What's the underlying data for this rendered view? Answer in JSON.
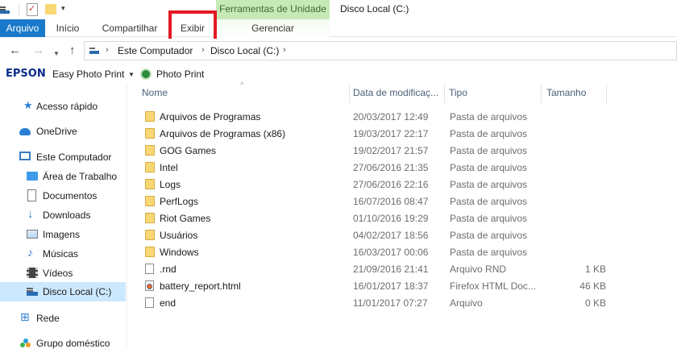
{
  "window": {
    "tools_context_label": "Ferramentas de Unidade",
    "title": "Disco Local (C:)"
  },
  "ribbon": {
    "tabs": [
      "Arquivo",
      "Início",
      "Compartilhar",
      "Exibir",
      "Gerenciar"
    ],
    "highlighted_tab": "Exibir",
    "highlight_color": "#e21a23",
    "file_tab_color": "#1979ca",
    "context_color": "#c7e9b6"
  },
  "address": {
    "crumbs": [
      "Este Computador",
      "Disco Local (C:)"
    ]
  },
  "epson": {
    "logo": "EPSON",
    "easy_photo_print": "Easy Photo Print",
    "photo_print": "Photo Print"
  },
  "navigation": {
    "items": [
      {
        "label": "Acesso rápido",
        "icon": "star-icon"
      },
      {
        "label": "OneDrive",
        "icon": "cloud-icon"
      },
      {
        "label": "Este Computador",
        "icon": "computer-icon"
      },
      {
        "label": "Área de Trabalho",
        "icon": "desktop-icon"
      },
      {
        "label": "Documentos",
        "icon": "document-icon"
      },
      {
        "label": "Downloads",
        "icon": "download-icon"
      },
      {
        "label": "Imagens",
        "icon": "image-icon"
      },
      {
        "label": "Músicas",
        "icon": "music-icon"
      },
      {
        "label": "Vídeos",
        "icon": "video-icon"
      },
      {
        "label": "Disco Local (C:)",
        "icon": "drive-icon",
        "selected": true
      },
      {
        "label": "Rede",
        "icon": "network-icon"
      },
      {
        "label": "Grupo doméstico",
        "icon": "homegroup-icon"
      }
    ]
  },
  "columns": [
    "Nome",
    "Data de modificaç...",
    "Tipo",
    "Tamanho"
  ],
  "files": [
    {
      "name": "Arquivos de Programas",
      "date": "20/03/2017 12:49",
      "type": "Pasta de arquivos",
      "size": "",
      "kind": "folder"
    },
    {
      "name": "Arquivos de Programas (x86)",
      "date": "19/03/2017 22:17",
      "type": "Pasta de arquivos",
      "size": "",
      "kind": "folder"
    },
    {
      "name": "GOG Games",
      "date": "19/02/2017 21:57",
      "type": "Pasta de arquivos",
      "size": "",
      "kind": "folder"
    },
    {
      "name": "Intel",
      "date": "27/06/2016 21:35",
      "type": "Pasta de arquivos",
      "size": "",
      "kind": "folder"
    },
    {
      "name": "Logs",
      "date": "27/06/2016 22:16",
      "type": "Pasta de arquivos",
      "size": "",
      "kind": "folder"
    },
    {
      "name": "PerfLogs",
      "date": "16/07/2016 08:47",
      "type": "Pasta de arquivos",
      "size": "",
      "kind": "folder"
    },
    {
      "name": "Riot Games",
      "date": "01/10/2016 19:29",
      "type": "Pasta de arquivos",
      "size": "",
      "kind": "folder"
    },
    {
      "name": "Usuários",
      "date": "04/02/2017 18:56",
      "type": "Pasta de arquivos",
      "size": "",
      "kind": "folder"
    },
    {
      "name": "Windows",
      "date": "16/03/2017 00:06",
      "type": "Pasta de arquivos",
      "size": "",
      "kind": "folder"
    },
    {
      "name": ".rnd",
      "date": "21/09/2016 21:41",
      "type": "Arquivo RND",
      "size": "1 KB",
      "kind": "file"
    },
    {
      "name": "battery_report.html",
      "date": "16/01/2017 18:37",
      "type": "Firefox HTML Doc...",
      "size": "46 KB",
      "kind": "html"
    },
    {
      "name": "end",
      "date": "11/01/2017 07:27",
      "type": "Arquivo",
      "size": "0 KB",
      "kind": "file"
    }
  ]
}
